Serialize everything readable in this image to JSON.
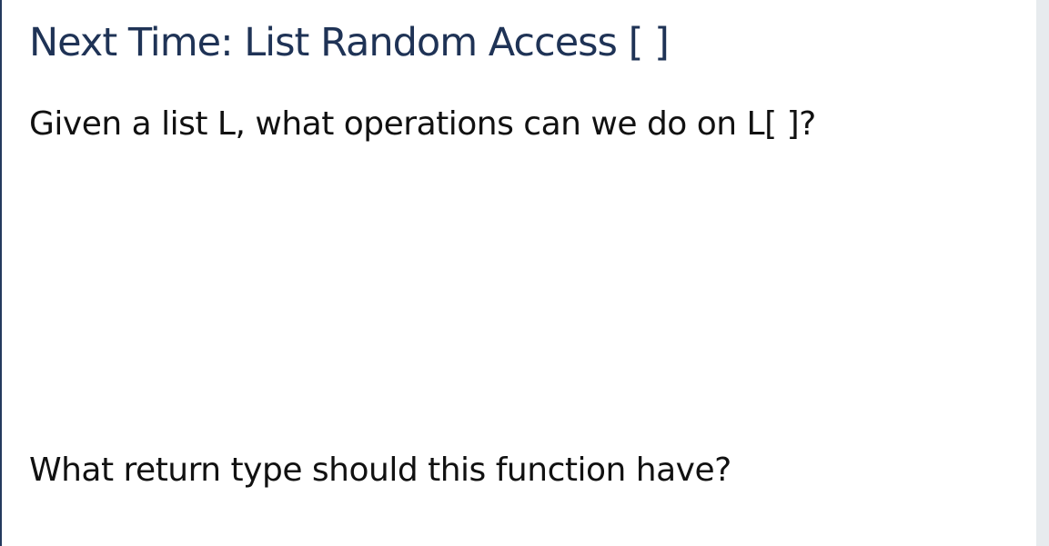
{
  "slide": {
    "title": "Next Time: List Random Access [ ]",
    "question_1": "Given a list L, what operations can we do on L[ ]?",
    "question_2": "What return type should this function have?"
  },
  "colors": {
    "title": "#1f3356",
    "body_text": "#111111",
    "left_border": "#243a5e",
    "right_strip": "#e7ebee",
    "background": "#ffffff"
  }
}
